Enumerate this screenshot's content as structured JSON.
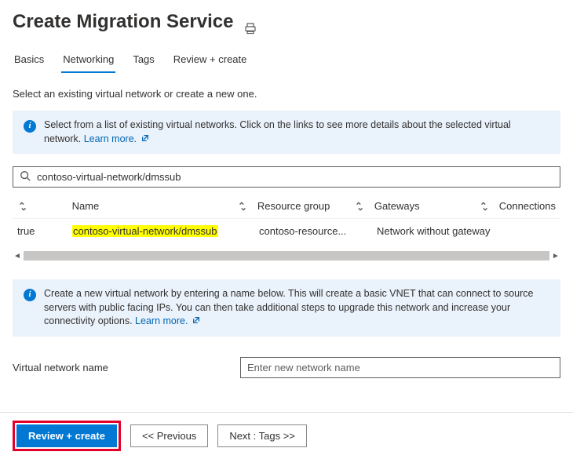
{
  "header": {
    "title": "Create Migration Service"
  },
  "tabs": [
    {
      "label": "Basics",
      "active": false
    },
    {
      "label": "Networking",
      "active": true
    },
    {
      "label": "Tags",
      "active": false
    },
    {
      "label": "Review + create",
      "active": false
    }
  ],
  "subtext": "Select an existing virtual network or create a new one.",
  "info_box_1": {
    "text": "Select from a list of existing virtual networks. Click on the links to see more details about the selected virtual network.",
    "learn_more": "Learn more."
  },
  "search": {
    "value": "contoso-virtual-network/dmssub"
  },
  "table": {
    "columns": [
      "",
      "Name",
      "Resource group",
      "Gateways",
      "Connections"
    ],
    "rows": [
      {
        "sel": "true",
        "name": "contoso-virtual-network/dmssub",
        "rg": "contoso-resource...",
        "gw": "Network without gateway",
        "conn": ""
      }
    ]
  },
  "info_box_2": {
    "text": "Create a new virtual network by entering a name below. This will create a basic VNET that can connect to source servers with public facing IPs. You can then take additional steps to upgrade this network and increase your connectivity options.",
    "learn_more": "Learn more."
  },
  "vnet_field": {
    "label": "Virtual network name",
    "placeholder": "Enter new network name",
    "value": ""
  },
  "footer": {
    "review": "Review + create",
    "previous": "<< Previous",
    "next": "Next : Tags >>"
  }
}
